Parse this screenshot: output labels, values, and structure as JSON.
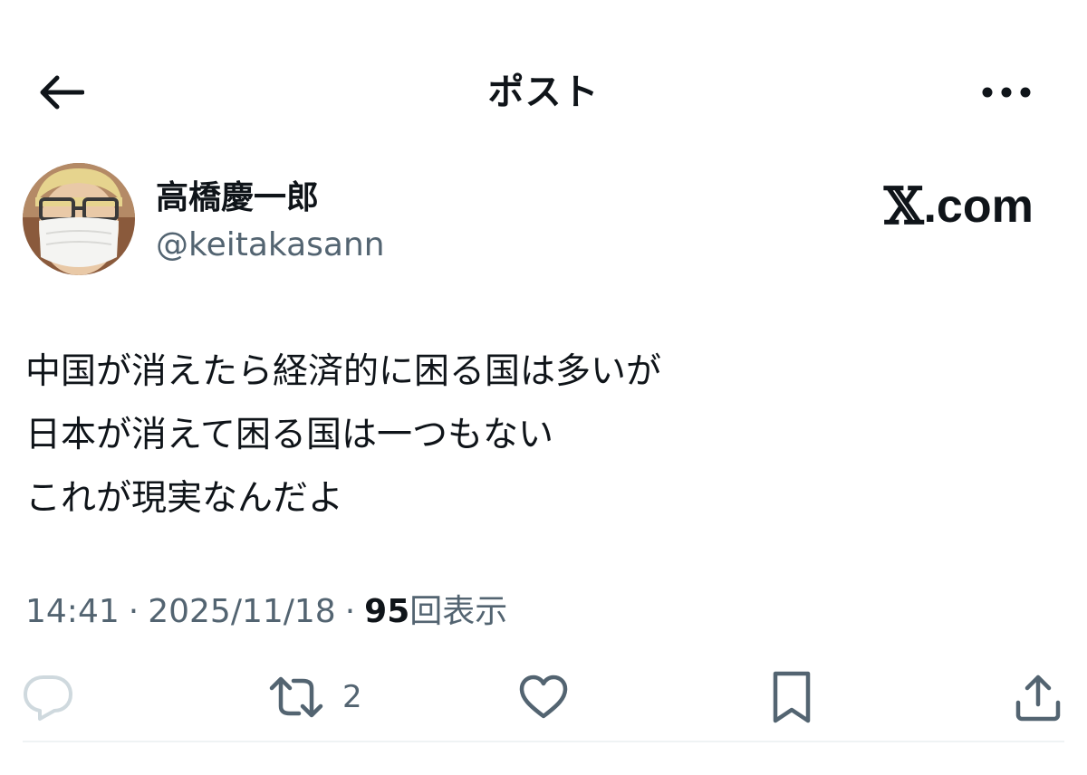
{
  "header": {
    "title": "ポスト",
    "back_icon": "arrow-left-icon",
    "more_icon": "more-horizontal-icon"
  },
  "author": {
    "name": "高橋慶一郎",
    "handle": "@keitakasann",
    "avatar_icon": "masked-face-avatar"
  },
  "brand": {
    "x_glyph": "𝕏",
    "suffix": ".com"
  },
  "post": {
    "lines": [
      "中国が消えたら経済的に困る国は多いが",
      "日本が消えて困る国は一つもない",
      "これが現実なんだよ"
    ]
  },
  "meta": {
    "time": "14:41",
    "separator": "·",
    "date": "2025/11/18",
    "views_count": "95",
    "views_label": "回表示"
  },
  "actions": {
    "reply_icon": "reply-icon",
    "repost_icon": "repost-icon",
    "repost_count": "2",
    "like_icon": "heart-icon",
    "bookmark_icon": "bookmark-icon",
    "share_icon": "share-icon"
  },
  "colors": {
    "text": "#0f1419",
    "secondary": "#536471",
    "reply_icon": "#cfd9de",
    "divider": "#eff3f4"
  }
}
